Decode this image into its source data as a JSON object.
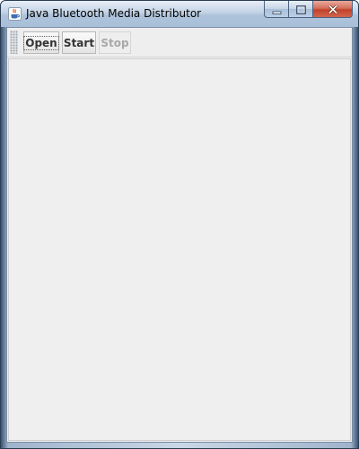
{
  "window": {
    "title": "Java Bluetooth Media Distributor",
    "app_icon": "java-cup-icon",
    "controls": {
      "minimize_icon": "minimize-icon",
      "maximize_icon": "maximize-icon",
      "close_icon": "close-icon"
    }
  },
  "toolbar": {
    "open_label": "Open",
    "start_label": "Start",
    "stop_label": "Stop",
    "stop_enabled": false
  },
  "colors": {
    "title_bar": "#b9cbe0",
    "close_button": "#c94a33",
    "client_background": "#f0f0f0"
  }
}
